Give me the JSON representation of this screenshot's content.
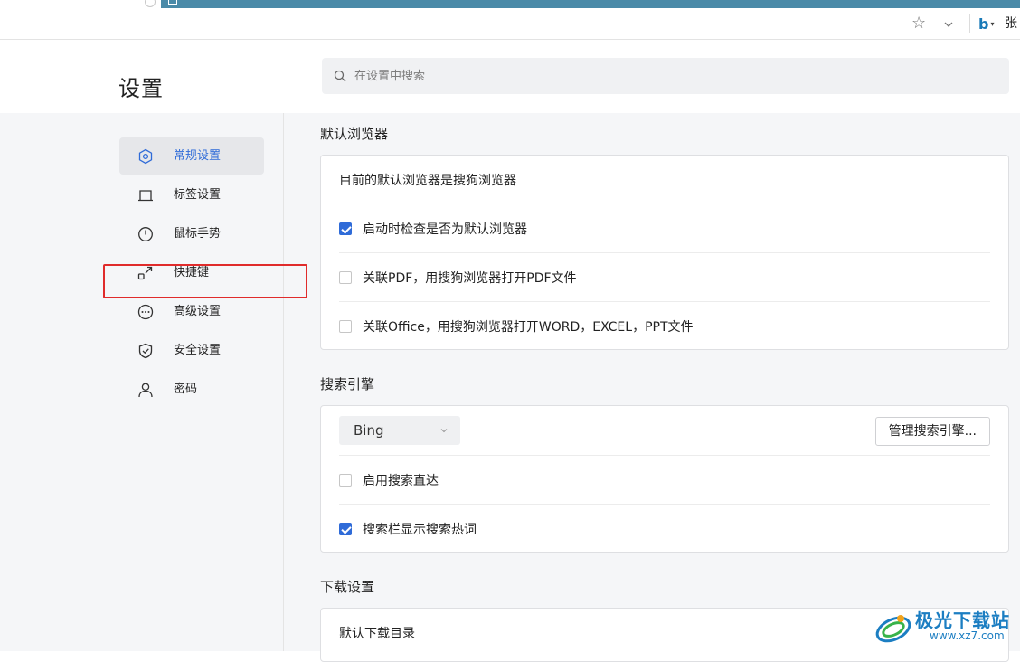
{
  "browser": {
    "user_label": "张",
    "search_engine_icon": "bing-b-icon"
  },
  "page": {
    "title": "设置",
    "search_placeholder": "在设置中搜索"
  },
  "sidebar": {
    "items": [
      {
        "label": "常规设置",
        "icon": "hexagon-gear-icon",
        "active": true
      },
      {
        "label": "标签设置",
        "icon": "tab-icon",
        "active": false
      },
      {
        "label": "鼠标手势",
        "icon": "mouse-icon",
        "active": false
      },
      {
        "label": "快捷键",
        "icon": "shortcut-icon",
        "active": false,
        "highlighted": true
      },
      {
        "label": "高级设置",
        "icon": "more-dots-icon",
        "active": false
      },
      {
        "label": "安全设置",
        "icon": "shield-check-icon",
        "active": false
      },
      {
        "label": "密码",
        "icon": "user-icon",
        "active": false
      }
    ]
  },
  "default_browser": {
    "section_title": "默认浏览器",
    "status_text": "目前的默认浏览器是搜狗浏览器",
    "options": [
      {
        "label": "启动时检查是否为默认浏览器",
        "checked": true
      },
      {
        "label": "关联PDF，用搜狗浏览器打开PDF文件",
        "checked": false
      },
      {
        "label": "关联Office，用搜狗浏览器打开WORD，EXCEL，PPT文件",
        "checked": false
      }
    ]
  },
  "search_engine": {
    "section_title": "搜索引擎",
    "selected": "Bing",
    "manage_button": "管理搜索引擎...",
    "options": [
      {
        "label": "启用搜索直达",
        "checked": false
      },
      {
        "label": "搜索栏显示搜索热词",
        "checked": true
      }
    ]
  },
  "download": {
    "section_title": "下载设置",
    "default_dir_label": "默认下载目录"
  },
  "watermark": {
    "title": "极光下载站",
    "url": "www.xz7.com"
  },
  "colors": {
    "accent": "#2f6bd8",
    "highlight_border": "#e02b2b",
    "tab_bar": "#4a8aa8"
  }
}
